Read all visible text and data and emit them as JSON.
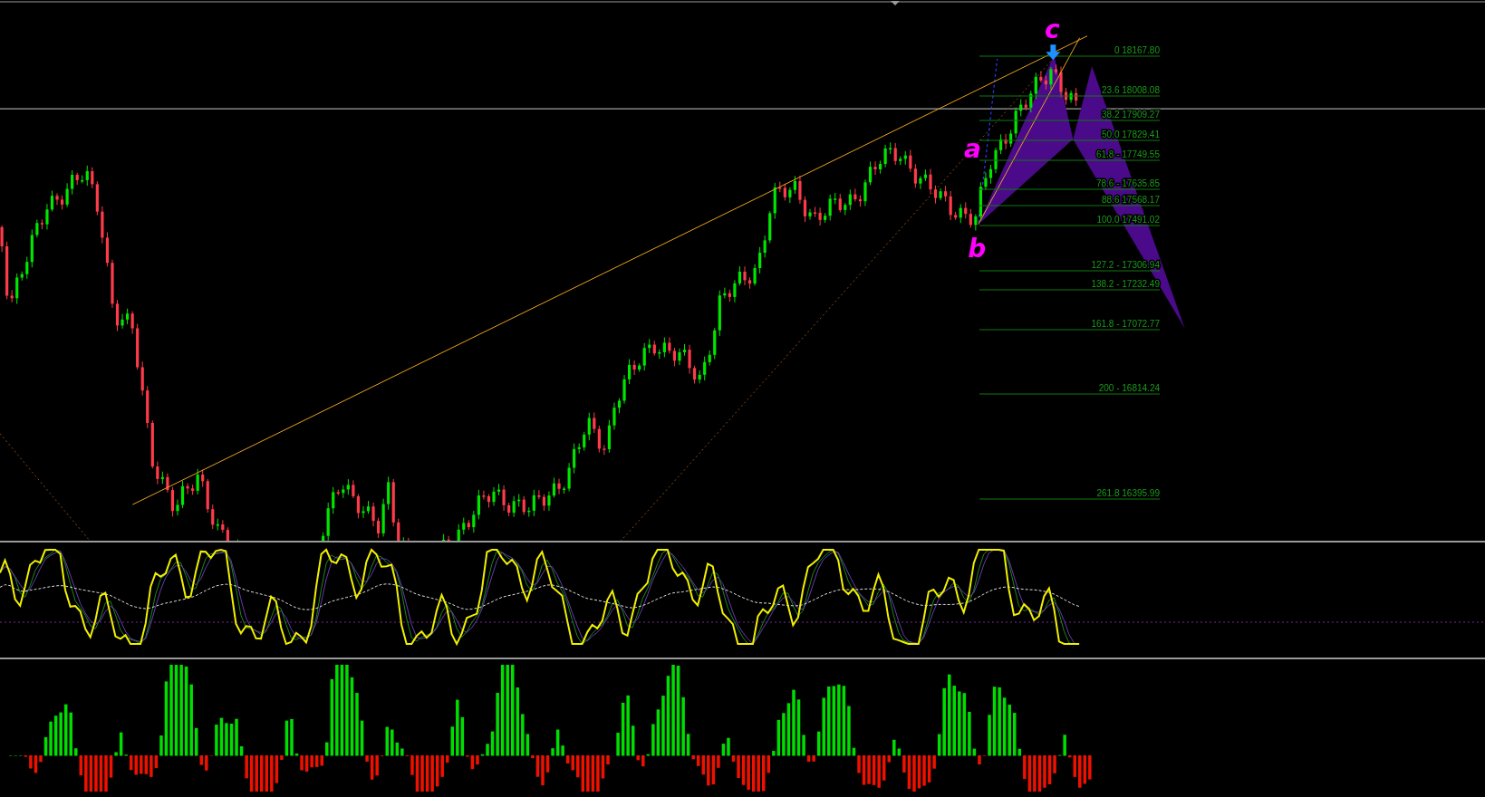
{
  "wave_labels": [
    {
      "text": "c"
    },
    {
      "text": "a"
    },
    {
      "text": "b"
    }
  ],
  "fib_levels": [
    {
      "label": "0 18167.80"
    },
    {
      "label": "23.6 18008.08"
    },
    {
      "label": "38.2 17909.27"
    },
    {
      "label": "50.0 17829.41"
    },
    {
      "label": "61.8 - 17749.55"
    },
    {
      "label": "78.6 - 17635.85"
    },
    {
      "label": "88.6 17568.17"
    },
    {
      "label": "100.0 17491.02"
    },
    {
      "label": "127.2 - 17306.94"
    },
    {
      "label": "138.2 - 17232.49"
    },
    {
      "label": "161.8 -  17072.77"
    },
    {
      "label": "200 - 16814.24"
    },
    {
      "label": "261.8 16395.99"
    }
  ]
}
